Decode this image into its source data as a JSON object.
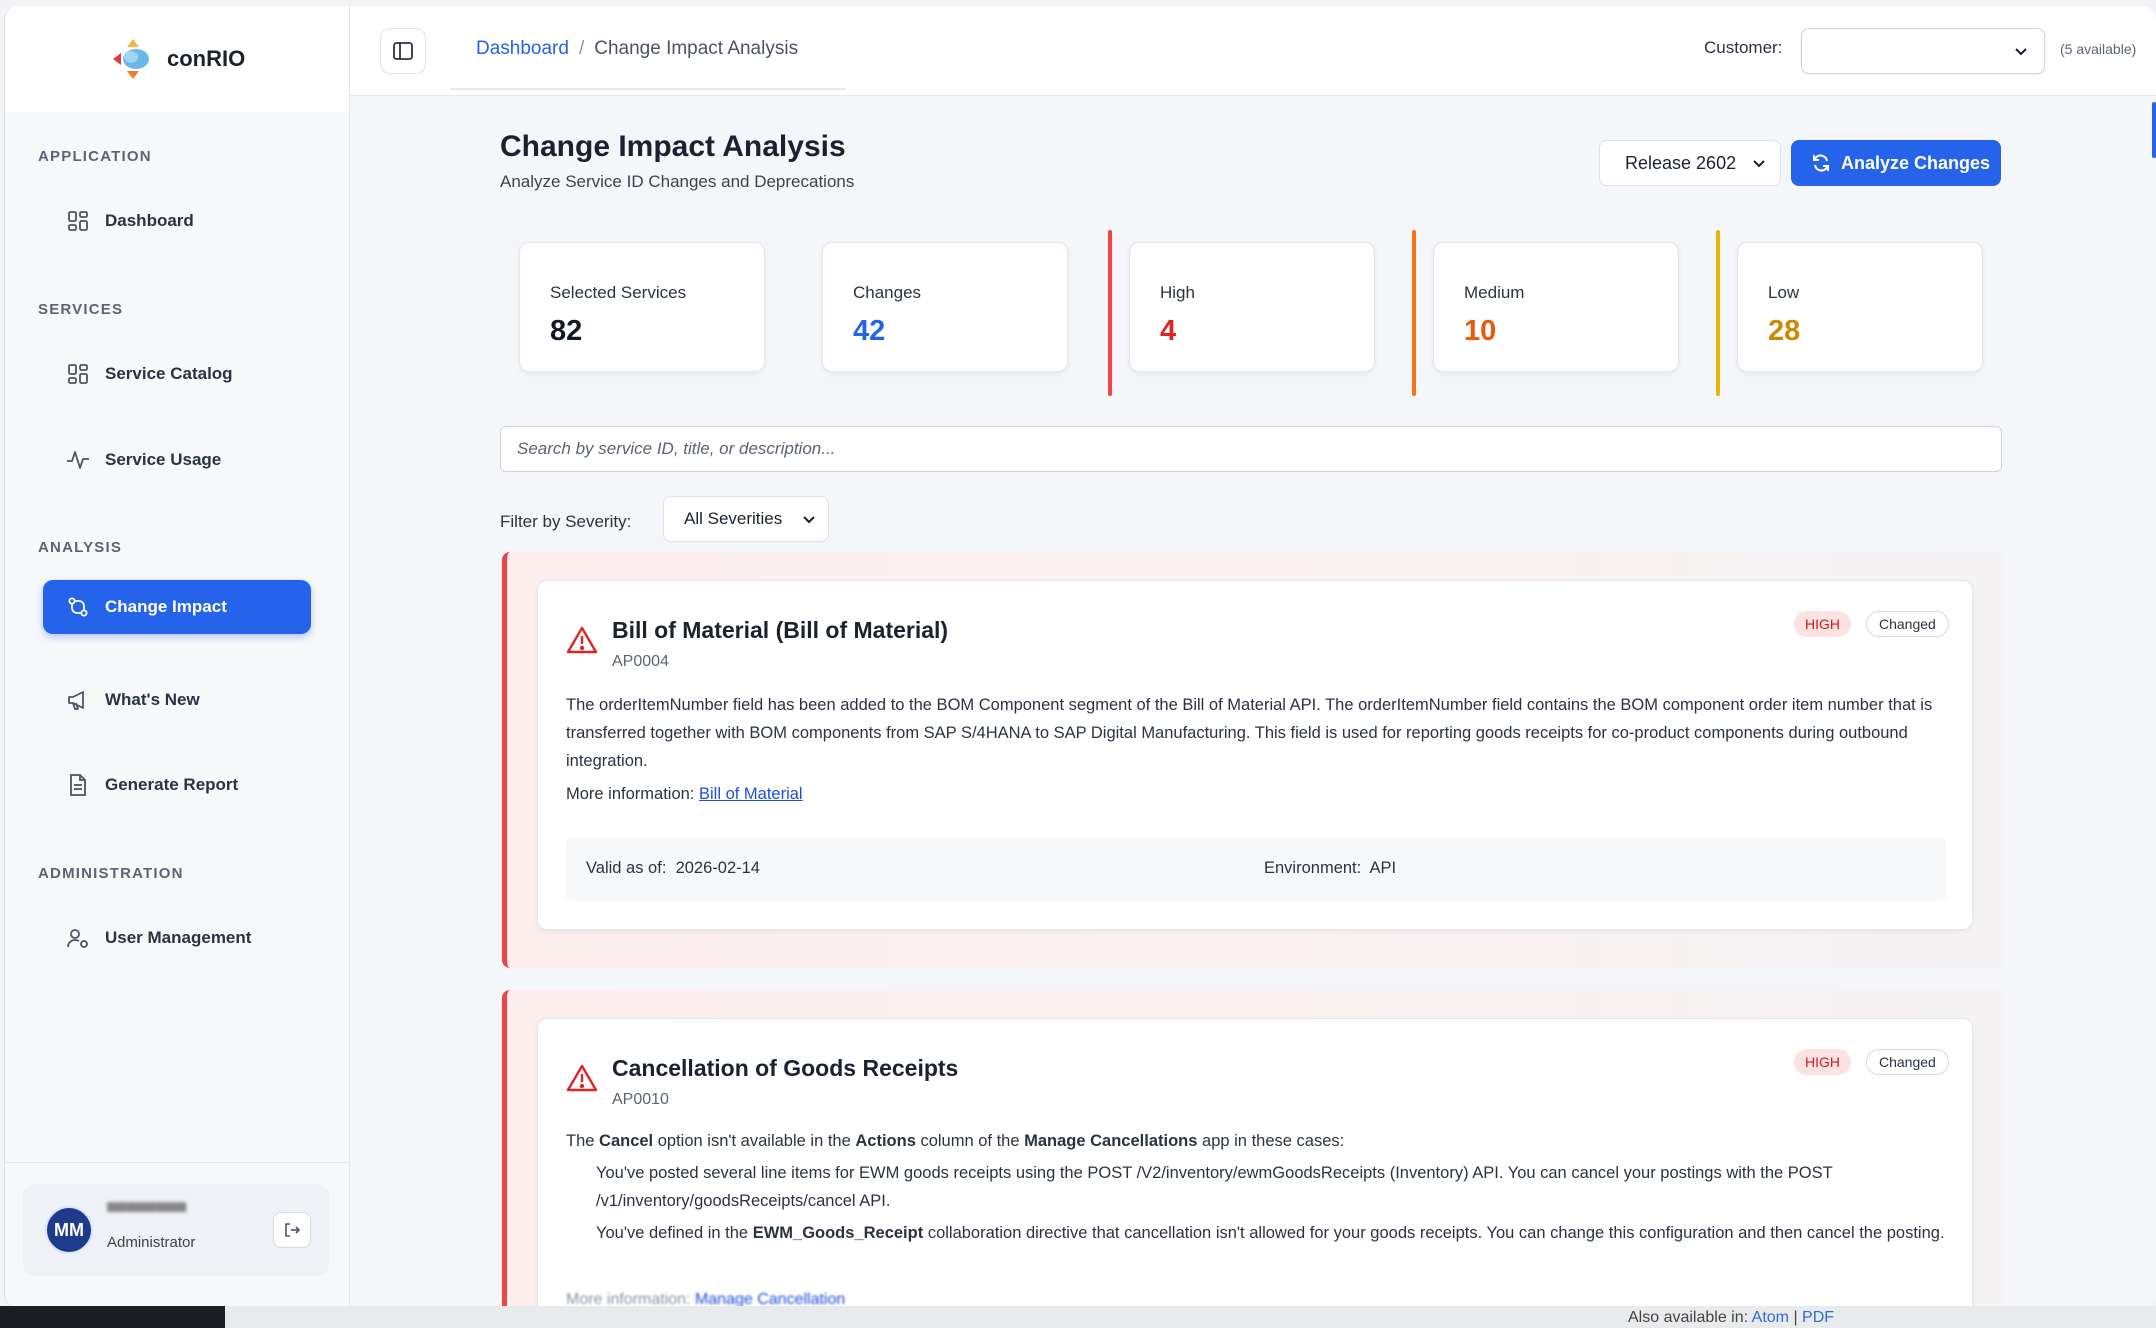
{
  "brand": {
    "name": "conRIO"
  },
  "sidebar": {
    "sections": [
      {
        "title": "APPLICATION"
      },
      {
        "title": "SERVICES"
      },
      {
        "title": "ANALYSIS"
      },
      {
        "title": "ADMINISTRATION"
      }
    ],
    "items": [
      {
        "label": "Dashboard",
        "icon": "grid-icon"
      },
      {
        "label": "Service Catalog",
        "icon": "grid-icon"
      },
      {
        "label": "Service Usage",
        "icon": "activity-icon"
      },
      {
        "label": "Change Impact",
        "icon": "git-compare-icon",
        "active": true
      },
      {
        "label": "What's New",
        "icon": "megaphone-icon"
      },
      {
        "label": "Generate Report",
        "icon": "document-icon"
      },
      {
        "label": "User Management",
        "icon": "user-cog-icon"
      }
    ],
    "user": {
      "initials": "MM",
      "role": "Administrator"
    }
  },
  "header": {
    "breadcrumb": {
      "link": "Dashboard",
      "separator": "/",
      "current": "Change Impact Analysis"
    },
    "customer_label": "Customer:",
    "customer_value": "",
    "customer_available": "(5 available)"
  },
  "main": {
    "title": "Change Impact Analysis",
    "subtitle": "Analyze Service ID Changes and Deprecations",
    "release": "Release 2602",
    "analyze_label": "Analyze Changes",
    "stats": [
      {
        "label": "Selected Services",
        "value": "82",
        "color": "#111827"
      },
      {
        "label": "Changes",
        "value": "42",
        "color": "#2563eb"
      },
      {
        "label": "High",
        "value": "4",
        "color": "#dc2626"
      },
      {
        "label": "Medium",
        "value": "10",
        "color": "#ea580c"
      },
      {
        "label": "Low",
        "value": "28",
        "color": "#ca8a04"
      }
    ],
    "search_placeholder": "Search by service ID, title, or description...",
    "filter_label": "Filter by Severity:",
    "filter_value": "All Severities"
  },
  "results": [
    {
      "title": "Bill of Material (Bill of Material)",
      "code": "AP0004",
      "severity": "HIGH",
      "status": "Changed",
      "description": "The orderItemNumber field has been added to the BOM Component segment of the Bill of Material API. The orderItemNumber field contains the BOM component order item number that is transferred together with BOM components from SAP S/4HANA to SAP Digital Manufacturing. This field is used for reporting goods receipts for co-product components during outbound integration.",
      "more_label": "More information:",
      "more_link": "Bill of Material",
      "valid_label": "Valid as of:",
      "valid_value": "2026-02-14",
      "env_label": "Environment:",
      "env_value": "API"
    },
    {
      "title": "Cancellation of Goods Receipts",
      "code": "AP0010",
      "severity": "HIGH",
      "status": "Changed",
      "intro_1": "The",
      "intro_b1": "Cancel",
      "intro_2": "option isn't available in the",
      "intro_b2": "Actions",
      "intro_3": "column of the",
      "intro_b3": "Manage Cancellations",
      "intro_4": "app in these cases:",
      "bullet_1": "You've posted several line items for EWM goods receipts using the POST /V2/inventory/ewmGoodsReceipts (Inventory) API. You can cancel your postings with the POST /v1/inventory/goodsReceipts/cancel API.",
      "bullet_2a": "You've defined in the",
      "bullet_2b": "EWM_Goods_Receipt",
      "bullet_2c": "collaboration directive that cancellation isn't allowed for your goods receipts. You can change this configuration and then cancel the posting.",
      "more_label": "More information:",
      "more_link": "Manage Cancellation"
    }
  ],
  "footer": {
    "also_label": "Also available in:",
    "atom": "Atom",
    "sep": "|",
    "pdf": "PDF"
  }
}
